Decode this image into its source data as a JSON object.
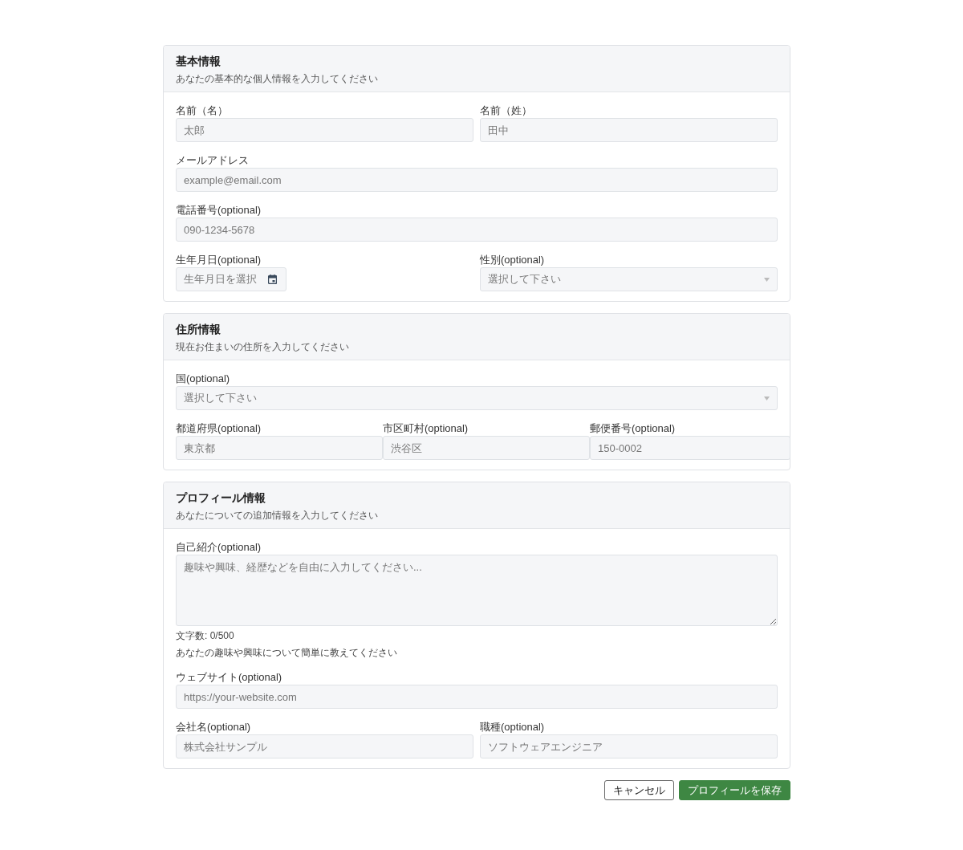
{
  "sections": [
    {
      "title": "基本情報",
      "subtitle": "あなたの基本的な個人情報を入力してください",
      "rows": [
        {
          "fields": [
            {
              "kind": "text",
              "label": "名前（名）",
              "placeholder": "太郎"
            },
            {
              "kind": "text",
              "label": "名前（姓）",
              "placeholder": "田中"
            }
          ]
        },
        {
          "fields": [
            {
              "kind": "text",
              "label": "メールアドレス",
              "placeholder": "example@email.com"
            }
          ]
        },
        {
          "fields": [
            {
              "kind": "text",
              "label": "電話番号(optional)",
              "placeholder": "090-1234-5678"
            }
          ]
        },
        {
          "fields": [
            {
              "kind": "date",
              "label": "生年月日(optional)",
              "placeholder": "生年月日を選択"
            },
            {
              "kind": "select",
              "label": "性別(optional)",
              "placeholder": "選択して下さい"
            }
          ]
        }
      ]
    },
    {
      "title": "住所情報",
      "subtitle": "現在お住まいの住所を入力してください",
      "rows": [
        {
          "fields": [
            {
              "kind": "select",
              "label": "国(optional)",
              "placeholder": "選択して下さい"
            }
          ]
        },
        {
          "fields": [
            {
              "kind": "text",
              "label": "都道府県(optional)",
              "placeholder": "東京都"
            },
            {
              "kind": "text",
              "label": "市区町村(optional)",
              "placeholder": "渋谷区"
            },
            {
              "kind": "text",
              "label": "郵便番号(optional)",
              "placeholder": "150-0002"
            }
          ]
        }
      ]
    },
    {
      "title": "プロフィール情報",
      "subtitle": "あなたについての追加情報を入力してください",
      "rows": [
        {
          "fields": [
            {
              "kind": "textarea",
              "label": "自己紹介(optional)",
              "placeholder": "趣味や興味、経歴などを自由に入力してください...",
              "count": "文字数: 0/500",
              "hint": "あなたの趣味や興味について簡単に教えてください"
            }
          ]
        },
        {
          "fields": [
            {
              "kind": "text",
              "label": "ウェブサイト(optional)",
              "placeholder": "https://your-website.com"
            }
          ]
        },
        {
          "fields": [
            {
              "kind": "text",
              "label": "会社名(optional)",
              "placeholder": "株式会社サンプル"
            },
            {
              "kind": "text",
              "label": "職種(optional)",
              "placeholder": "ソフトウェアエンジニア"
            }
          ]
        }
      ]
    }
  ],
  "actions": [
    {
      "kind": "secondary",
      "label": "キャンセル"
    },
    {
      "kind": "primary",
      "label": "プロフィールを保存"
    }
  ]
}
